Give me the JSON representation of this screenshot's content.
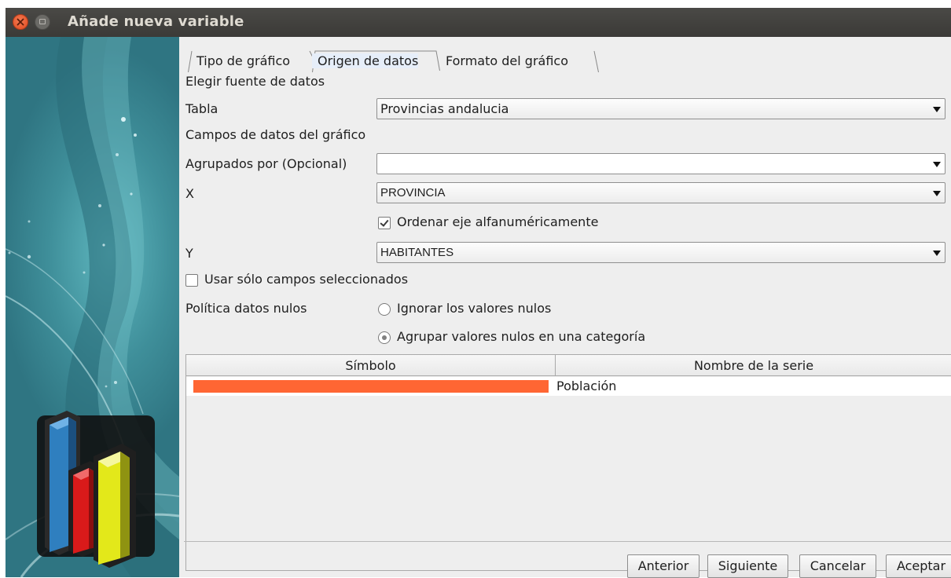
{
  "window": {
    "title": "Añade nueva variable"
  },
  "tabs": [
    {
      "label": "Tipo de gráfico",
      "selected": false
    },
    {
      "label": "Origen de datos",
      "selected": true
    },
    {
      "label": "Formato del gráfico",
      "selected": false
    }
  ],
  "form": {
    "source_heading": "Elegir fuente de datos",
    "table_label": "Tabla",
    "table_value": "Provincias andalucia",
    "fields_heading": "Campos de datos del gráfico",
    "group_label": "Agrupados por (Opcional)",
    "group_value": "",
    "x_label": "X",
    "x_value": "PROVINCIA",
    "sort_label": "Ordenar eje alfanuméricamente",
    "sort_checked": true,
    "y_label": "Y",
    "y_value": "HABITANTES",
    "selected_only_label": "Usar sólo campos seleccionados",
    "selected_only_checked": false,
    "null_policy_label": "Política datos nulos",
    "null_options": [
      {
        "label": "Ignorar los valores nulos",
        "checked": false
      },
      {
        "label": "Agrupar valores nulos en una categoría",
        "checked": true
      }
    ]
  },
  "series_table": {
    "columns": [
      "Símbolo",
      "Nombre de la serie"
    ],
    "rows": [
      {
        "color": "#ff6633",
        "name": "Población"
      }
    ]
  },
  "buttons": {
    "previous": "Anterior",
    "next": "Siguiente",
    "cancel": "Cancelar",
    "accept": "Aceptar"
  },
  "icons": {
    "close": "close-icon",
    "minimize": "minimize-icon",
    "dropdown": "chevron-down-icon",
    "logo": "bar-chart-logo"
  }
}
